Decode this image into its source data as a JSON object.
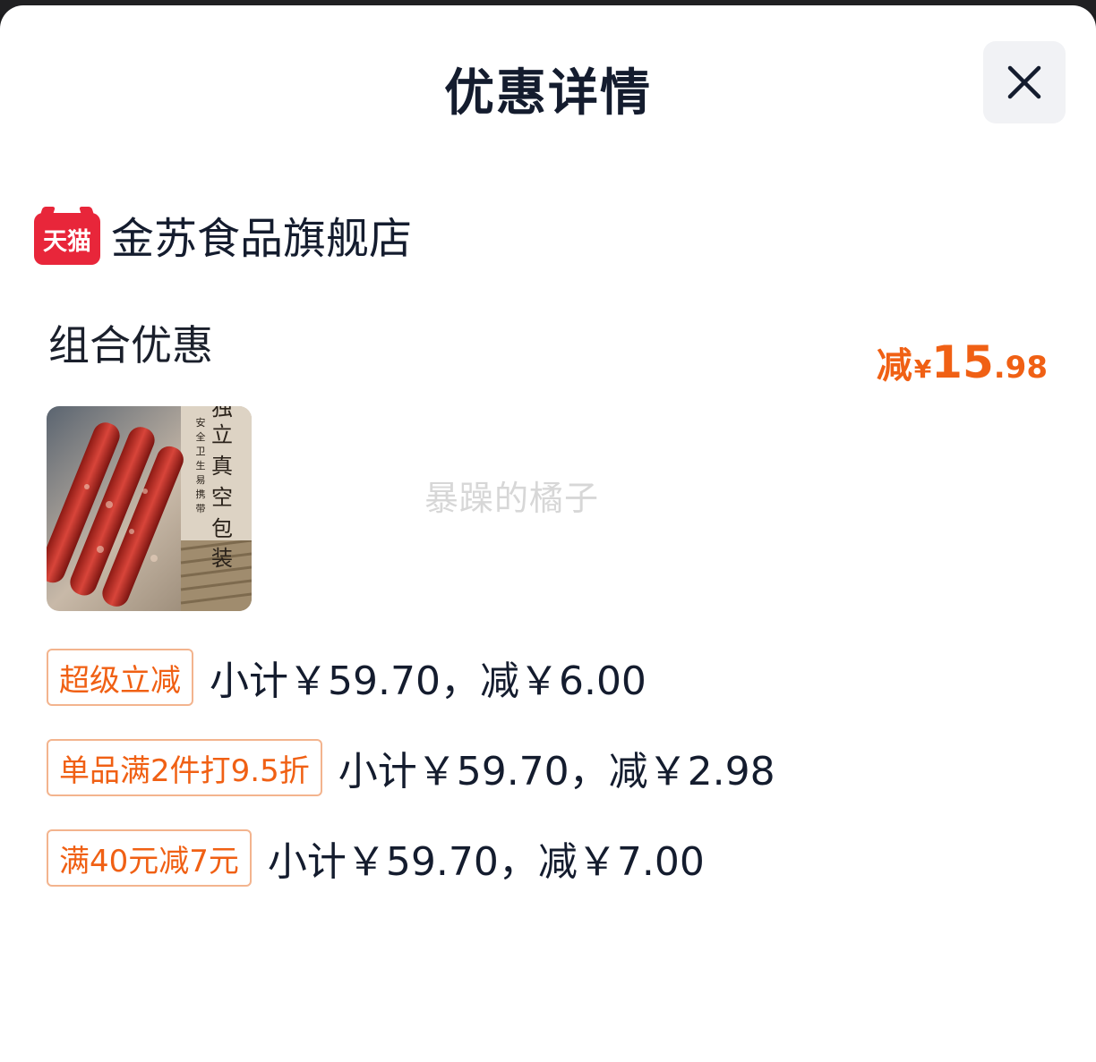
{
  "header": {
    "title": "优惠详情",
    "close_icon": "close-icon"
  },
  "store": {
    "badge_text": "天猫",
    "name": "金苏食品旗舰店"
  },
  "promo": {
    "section_title": "组合优惠",
    "total_prefix": "减",
    "total_currency": "¥",
    "total_int": "15",
    "total_dec": ".98"
  },
  "product": {
    "image_text": "独立真空包装",
    "image_subtext": "安全卫生易携带"
  },
  "watermark": "暴躁的橘子",
  "discounts": [
    {
      "tag": "超级立减",
      "detail": "小计￥59.70，减￥6.00"
    },
    {
      "tag": "单品满2件打9.5折",
      "detail": "小计￥59.70，减￥2.98"
    },
    {
      "tag": "满40元减7元",
      "detail": "小计￥59.70，减￥7.00"
    }
  ],
  "colors": {
    "accent": "#f06014",
    "tag_border": "#f3b48e",
    "tmall_red": "#e8263a",
    "text": "#141c2e"
  }
}
